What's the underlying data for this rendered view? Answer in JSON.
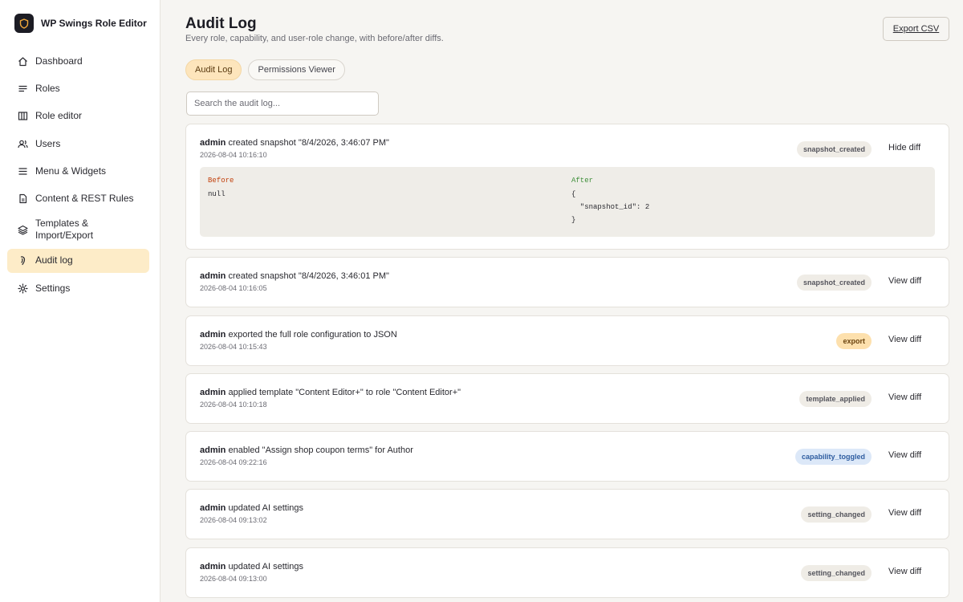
{
  "app": {
    "title": "WP Swings Role Editor"
  },
  "sidebar": {
    "items": [
      {
        "label": "Dashboard",
        "icon": "home-icon"
      },
      {
        "label": "Roles",
        "icon": "list-icon"
      },
      {
        "label": "Role editor",
        "icon": "columns-icon"
      },
      {
        "label": "Users",
        "icon": "users-icon"
      },
      {
        "label": "Menu & Widgets",
        "icon": "menu-icon"
      },
      {
        "label": "Content & REST Rules",
        "icon": "document-icon"
      },
      {
        "label": "Templates & Import/Export",
        "icon": "layers-icon"
      },
      {
        "label": "Audit log",
        "icon": "fingerprint-icon",
        "active": true
      },
      {
        "label": "Settings",
        "icon": "gear-icon"
      }
    ]
  },
  "header": {
    "title": "Audit Log",
    "subtitle": "Every role, capability, and user-role change, with before/after diffs.",
    "export_label": "Export CSV"
  },
  "tabs": [
    {
      "label": "Audit Log",
      "active": true
    },
    {
      "label": "Permissions Viewer",
      "active": false
    }
  ],
  "search": {
    "placeholder": "Search the audit log...",
    "value": ""
  },
  "colors": {
    "accent": "#fde5bc",
    "active_nav": "#fdecc8",
    "sidebar_bg": "#ffffff",
    "page_bg": "#f6f5f2"
  },
  "entries": [
    {
      "actor": "admin",
      "action": " created snapshot \"8/4/2026, 3:46:07 PM\"",
      "time": "2026-08-04 10:16:10",
      "badge": "snapshot_created",
      "toggle": "Hide diff",
      "diff": {
        "before_label": "Before",
        "after_label": "After",
        "before_lines": [
          "null"
        ],
        "after_lines": [
          "{",
          "  \"snapshot_id\": 2",
          "}"
        ]
      }
    },
    {
      "actor": "admin",
      "action": " created snapshot \"8/4/2026, 3:46:01 PM\"",
      "time": "2026-08-04 10:16:05",
      "badge": "snapshot_created",
      "toggle": "View diff"
    },
    {
      "actor": "admin",
      "action": " exported the full role configuration to JSON",
      "time": "2026-08-04 10:15:43",
      "badge": "export",
      "toggle": "View diff"
    },
    {
      "actor": "admin",
      "action": " applied template \"Content Editor+\" to role \"Content Editor+\"",
      "time": "2026-08-04 10:10:18",
      "badge": "template_applied",
      "toggle": "View diff"
    },
    {
      "actor": "admin",
      "action": " enabled \"Assign shop coupon terms\" for Author",
      "time": "2026-08-04 09:22:16",
      "badge": "capability_toggled",
      "toggle": "View diff"
    },
    {
      "actor": "admin",
      "action": " updated AI settings",
      "time": "2026-08-04 09:13:02",
      "badge": "setting_changed",
      "toggle": "View diff"
    },
    {
      "actor": "admin",
      "action": " updated AI settings",
      "time": "2026-08-04 09:13:00",
      "badge": "setting_changed",
      "toggle": "View diff"
    }
  ]
}
